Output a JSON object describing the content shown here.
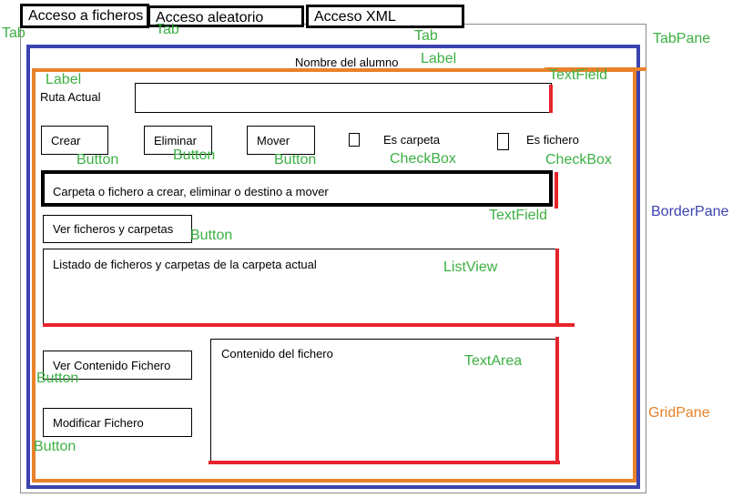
{
  "tabs": [
    {
      "label": "Acceso a ficheros"
    },
    {
      "label": "Acceso aleatorio"
    },
    {
      "label": "Acceso XML"
    }
  ],
  "annotations": {
    "tab": "Tab",
    "tabpane": "TabPane",
    "borderpane": "BorderPane",
    "gridpane": "GridPane",
    "label": "Label",
    "textfield": "TextField",
    "button": "Button",
    "checkbox": "CheckBox",
    "listview": "ListView",
    "textarea": "TextArea"
  },
  "form": {
    "student_name": "Nombre del alumno",
    "ruta_label": "Ruta Actual",
    "crear": "Crear",
    "eliminar": "Eliminar",
    "mover": "Mover",
    "es_carpeta": "Es carpeta",
    "es_fichero": "Es fichero",
    "target_field": "Carpeta o fichero a crear, eliminar o destino a mover",
    "ver_ficheros": "Ver ficheros y carpetas",
    "listado": "Listado de ficheros y carpetas de la carpeta actual",
    "ver_contenido": "Ver Contenido Fichero",
    "modificar": "Modificar Fichero",
    "contenido": "Contenido del fichero"
  },
  "colors": {
    "annotation_green": "#3cb043",
    "borderpane_blue": "#3c43b0",
    "gridpane_orange": "#e8822a",
    "textfield_red": "#e8232b"
  }
}
